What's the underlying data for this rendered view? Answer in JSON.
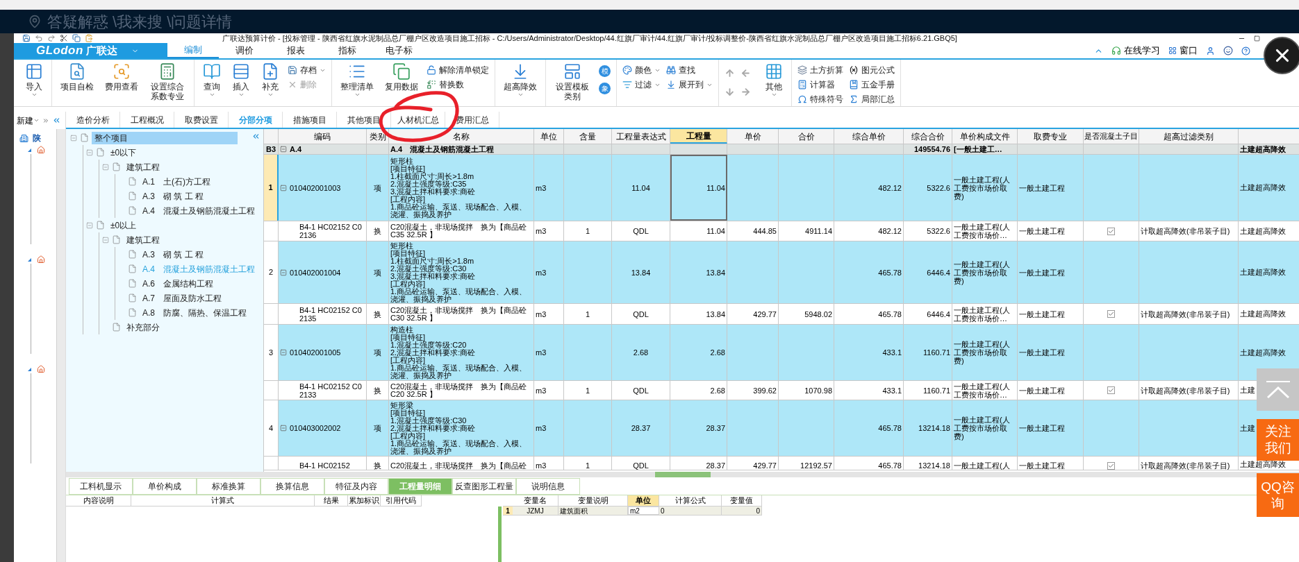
{
  "top_bar": {
    "breadcrumb": "答疑解惑 \\我来搜 \\问题详情"
  },
  "window": {
    "title": "广联达预算计价 - [投标管理 - 陕西省红旗水泥制品总厂棚户区改造项目施工招标 - C:/Users/Administrator/Desktop/44.红旗厂审计/44.红旗厂审计/投标调整价-陕西省红旗水泥制品总厂棚户区改造项目施工招标6.21.GBQ5]"
  },
  "logo": {
    "wordmark": "GLodon",
    "brand": "广联达"
  },
  "menu_tabs": [
    {
      "label": "编制",
      "selected": true
    },
    {
      "label": "调价",
      "selected": false
    },
    {
      "label": "报表",
      "selected": false
    },
    {
      "label": "指标",
      "selected": false
    },
    {
      "label": "电子标",
      "selected": false
    }
  ],
  "right_menu": {
    "learn": "在线学习",
    "window": "窗口"
  },
  "ribbon": [
    {
      "items": [
        {
          "kind": "large",
          "label": "导入",
          "dropdown": true
        }
      ]
    },
    {
      "items": [
        {
          "kind": "large",
          "label": "项目自检",
          "dropdown": false
        },
        {
          "kind": "large",
          "label": "费用查看",
          "dropdown": false
        },
        {
          "kind": "large",
          "label": "设置综合系数专业",
          "dropdown": false
        }
      ]
    },
    {
      "items": [
        {
          "kind": "large",
          "label": "查询",
          "dropdown": true
        },
        {
          "kind": "large",
          "label": "插入",
          "dropdown": true
        },
        {
          "kind": "large",
          "label": "补充",
          "dropdown": true
        },
        {
          "kind": "stack",
          "items": [
            {
              "label": "存档",
              "dropdown": true,
              "disabled": false
            },
            {
              "label": "删除",
              "dropdown": false,
              "disabled": true
            }
          ]
        }
      ]
    },
    {
      "items": [
        {
          "kind": "large",
          "label": "整理清单",
          "dropdown": true
        },
        {
          "kind": "large",
          "label": "复用数据",
          "dropdown": false
        },
        {
          "kind": "stack",
          "items": [
            {
              "label": "解除清单锁定",
              "dropdown": false,
              "disabled": false
            },
            {
              "label": "替换数",
              "dropdown": false,
              "disabled": false
            }
          ]
        }
      ]
    },
    {
      "items": [
        {
          "kind": "large",
          "label": "超高降效",
          "dropdown": true
        }
      ]
    },
    {
      "items": [
        {
          "kind": "large",
          "label": "设置模板类别",
          "dropdown": false
        },
        {
          "kind": "badges",
          "items": [
            "模",
            "象"
          ]
        }
      ]
    },
    {
      "items": [
        {
          "kind": "stack",
          "items": [
            {
              "label": "颜色",
              "dropdown": true,
              "disabled": false
            },
            {
              "label": "过滤",
              "dropdown": true,
              "disabled": false
            }
          ]
        },
        {
          "kind": "stack",
          "items": [
            {
              "label": "查找",
              "dropdown": false,
              "disabled": false
            },
            {
              "label": "展开到",
              "dropdown": true,
              "disabled": false
            }
          ]
        }
      ]
    },
    {
      "items": [
        {
          "kind": "arrows"
        },
        {
          "kind": "large",
          "label": "其他",
          "dropdown": true
        }
      ]
    },
    {
      "items": [
        {
          "kind": "stack",
          "items": [
            {
              "label": "土方折算",
              "dropdown": false,
              "disabled": false
            },
            {
              "label": "计算器",
              "dropdown": false,
              "disabled": false
            },
            {
              "label": "特殊符号",
              "dropdown": false,
              "disabled": false
            }
          ]
        },
        {
          "kind": "stack",
          "items": [
            {
              "label": "图元公式",
              "dropdown": false,
              "disabled": false
            },
            {
              "label": "五金手册",
              "dropdown": false,
              "disabled": false
            },
            {
              "label": "局部汇总",
              "dropdown": false,
              "disabled": false
            }
          ]
        }
      ]
    }
  ],
  "new_button": {
    "label": "新建"
  },
  "sidebar": {
    "title": "陕"
  },
  "view_tabs": [
    {
      "label": "造价分析",
      "selected": false
    },
    {
      "label": "工程概况",
      "selected": false
    },
    {
      "label": "取费设置",
      "selected": false
    },
    {
      "label": "分部分项",
      "selected": true
    },
    {
      "label": "措施项目",
      "selected": false
    },
    {
      "label": "其他项目",
      "selected": false
    },
    {
      "label": "人材机汇总",
      "selected": false
    },
    {
      "label": "费用汇总",
      "selected": false
    }
  ],
  "tree": [
    {
      "name": "整个项目",
      "selected": true,
      "active": false,
      "expanded": true,
      "children": [
        {
          "name": "±0以下",
          "selected": false,
          "active": false,
          "expanded": true,
          "children": [
            {
              "name": "建筑工程",
              "selected": false,
              "active": false,
              "expanded": true,
              "children": [
                {
                  "code": "A.1",
                  "name": "土(石)方工程",
                  "selected": false,
                  "active": false
                },
                {
                  "code": "A.3",
                  "name": "砌 筑 工 程",
                  "selected": false,
                  "active": false
                },
                {
                  "code": "A.4",
                  "name": "混凝土及钢筋混凝土工程",
                  "selected": false,
                  "active": false
                }
              ]
            }
          ]
        },
        {
          "name": "±0以上",
          "selected": false,
          "active": false,
          "expanded": true,
          "children": [
            {
              "name": "建筑工程",
              "selected": false,
              "active": false,
              "expanded": true,
              "children": [
                {
                  "code": "A.3",
                  "name": "砌 筑 工 程",
                  "selected": false,
                  "active": false
                },
                {
                  "code": "A.4",
                  "name": "混凝土及钢筋混凝土工程",
                  "selected": false,
                  "active": true
                },
                {
                  "code": "A.6",
                  "name": "金属结构工程",
                  "selected": false,
                  "active": false
                },
                {
                  "code": "A.7",
                  "name": "屋面及防水工程",
                  "selected": false,
                  "active": false
                },
                {
                  "code": "A.8",
                  "name": "防腐、隔热、保温工程",
                  "selected": false,
                  "active": false
                }
              ]
            },
            {
              "name": "补充部分",
              "selected": false,
              "active": false
            }
          ]
        }
      ]
    }
  ],
  "table": {
    "columns": [
      {
        "label": "编码",
        "selected": false
      },
      {
        "label": "类别",
        "selected": false
      },
      {
        "label": "名称",
        "selected": false
      },
      {
        "label": "单位",
        "selected": false
      },
      {
        "label": "含量",
        "selected": false
      },
      {
        "label": "工程量表达式",
        "selected": false
      },
      {
        "label": "工程量",
        "selected": true
      },
      {
        "label": "单价",
        "selected": false
      },
      {
        "label": "合价",
        "selected": false
      },
      {
        "label": "综合单价",
        "selected": false
      },
      {
        "label": "综合合价",
        "selected": false
      },
      {
        "label": "单价构成文件",
        "selected": false
      },
      {
        "label": "取费专业",
        "selected": false
      },
      {
        "label": "是否混凝土子目",
        "selected": false
      },
      {
        "label": "超高过滤类别",
        "selected": false
      }
    ],
    "rows": [
      {
        "kind": "group",
        "no": "B3",
        "selected": false,
        "code": "A.4",
        "name": "A.4　混凝土及钢筋混凝土工程",
        "sum": "149554.76",
        "file": "[一般土建工…",
        "extra": "土建超高降效"
      },
      {
        "kind": "item",
        "no": "1",
        "selected": true,
        "code": "010402001003",
        "type": "项",
        "name": "矩形柱\n[项目特征]\n1.柱截面尺寸:周长>1.8m\n2.混凝土强度等级:C35\n3.混凝土拌和料要求:商砼\n[工程内容]\n1.商品砼运输、泵送、现场配合、入模、浇灌、振捣及养护",
        "unit": "m3",
        "expr": "11.04",
        "qty": "11.04",
        "unit_price": "482.12",
        "sum": "5322.6",
        "file": "一般土建工程(人工费按市场价取费)",
        "fee": "一般土建工程",
        "extra": "土建超高降效"
      },
      {
        "kind": "sub",
        "selected": false,
        "code": "B4-1 HC02152 C02136",
        "type": "换",
        "name": "C20混凝土，非现场搅拌　换为【商品砼C35 32.5R 】",
        "unit": "m3",
        "content": "1",
        "expr": "QDL",
        "qty": "11.04",
        "price": "444.85",
        "total": "4911.14",
        "unit_price": "482.12",
        "sum": "5322.6",
        "file": "一般土建工程(人工费按市场价…",
        "fee": "一般土建工程",
        "concrete": true,
        "filter": "计取超高降效(非吊装子目)",
        "extra": "土建超高降效"
      },
      {
        "kind": "item",
        "no": "2",
        "selected": false,
        "code": "010402001004",
        "type": "项",
        "name": "矩形柱\n[项目特征]\n1.柱截面尺寸:周长>1.8m\n2.混凝土强度等级:C30\n3.混凝土拌和料要求:商砼\n[工程内容]\n1.商品砼运输、泵送、现场配合、入模、浇灌、振捣及养护",
        "unit": "m3",
        "expr": "13.84",
        "qty": "13.84",
        "unit_price": "465.78",
        "sum": "6446.4",
        "file": "一般土建工程(人工费按市场价取费)",
        "fee": "一般土建工程",
        "extra": "土建超高降效"
      },
      {
        "kind": "sub",
        "selected": false,
        "code": "B4-1 HC02152 C02135",
        "type": "换",
        "name": "C20混凝土，非现场搅拌　换为【商品砼C30 32.5R 】",
        "unit": "m3",
        "content": "1",
        "expr": "QDL",
        "qty": "13.84",
        "price": "429.77",
        "total": "5948.02",
        "unit_price": "465.78",
        "sum": "6446.4",
        "file": "一般土建工程(人工费按市场价…",
        "fee": "一般土建工程",
        "concrete": true,
        "filter": "计取超高降效(非吊装子目)",
        "extra": "土建超高降效"
      },
      {
        "kind": "item",
        "no": "3",
        "selected": false,
        "code": "010402001005",
        "type": "项",
        "name": "构造柱\n[项目特征]\n1.混凝土强度等级:C20\n2.混凝土拌和料要求:商砼\n[工程内容]\n1.商品砼运输、泵送、现场配合、入模、浇灌、振捣及养护",
        "unit": "m3",
        "expr": "2.68",
        "qty": "2.68",
        "unit_price": "433.1",
        "sum": "1160.71",
        "file": "一般土建工程(人工费按市场价取费)",
        "fee": "一般土建工程",
        "extra": "土建超高降效"
      },
      {
        "kind": "sub",
        "selected": false,
        "code": "B4-1 HC02152 C02133",
        "type": "换",
        "name": "C20混凝土，非现场搅拌　换为【商品砼C20 32.5R 】",
        "unit": "m3",
        "content": "1",
        "expr": "QDL",
        "qty": "2.68",
        "price": "399.62",
        "total": "1070.98",
        "unit_price": "433.1",
        "sum": "1160.71",
        "file": "一般土建工程(人工费按市场价…",
        "fee": "一般土建工程",
        "concrete": true,
        "filter": "计取超高降效(非吊装子目)",
        "extra": "土建"
      },
      {
        "kind": "item",
        "no": "4",
        "selected": false,
        "code": "010403002002",
        "type": "项",
        "name": "矩形梁\n[项目特征]\n1.混凝土强度等级:C30\n2.混凝土拌和料要求:商砼\n[工程内容]\n1.商品砼运输、泵送、现场配合、入模、浇灌、振捣及养护",
        "unit": "m3",
        "expr": "28.37",
        "qty": "28.37",
        "unit_price": "465.78",
        "sum": "13214.18",
        "file": "一般土建工程(人工费按市场价取费)",
        "fee": "一般土建工程",
        "extra": "土建"
      },
      {
        "kind": "sub",
        "selected": false,
        "code": "B4-1 HC02152",
        "type": "换",
        "name": "C20混凝土，非现场搅拌　换为【商品砼",
        "unit": "m3",
        "content": "1",
        "expr": "QDL",
        "qty": "28.37",
        "price": "429.77",
        "total": "12192.57",
        "unit_price": "465.78",
        "sum": "13214.18",
        "file": "一般土建工程(人",
        "fee": "一般土建工程",
        "concrete": true,
        "filter": "计取超高降效(非吊装子目)",
        "extra": "土建超高降效"
      }
    ]
  },
  "bottom_tabs": [
    {
      "label": "工料机显示",
      "selected": false
    },
    {
      "label": "单价构成",
      "selected": false
    },
    {
      "label": "标准换算",
      "selected": false
    },
    {
      "label": "换算信息",
      "selected": false
    },
    {
      "label": "特征及内容",
      "selected": false
    },
    {
      "label": "工程量明细",
      "selected": true
    },
    {
      "label": "反查图形工程量",
      "selected": false
    },
    {
      "label": "说明信息",
      "selected": false
    }
  ],
  "detail_columns": [
    "内容说明",
    "计算式",
    "结果",
    "累加标识",
    "引用代码"
  ],
  "variables": {
    "columns": [
      {
        "label": "变量名",
        "selected": false
      },
      {
        "label": "变量说明",
        "selected": false
      },
      {
        "label": "单位",
        "selected": true
      },
      {
        "label": "计算公式",
        "selected": false
      },
      {
        "label": "变量值",
        "selected": false
      }
    ],
    "rows": [
      {
        "no": "1",
        "cells": [
          "JZMJ",
          "建筑面积",
          "m2",
          "0",
          "0"
        ]
      }
    ]
  },
  "float_buttons": {
    "follow": "关注我们",
    "qq": "QQ咨询"
  }
}
